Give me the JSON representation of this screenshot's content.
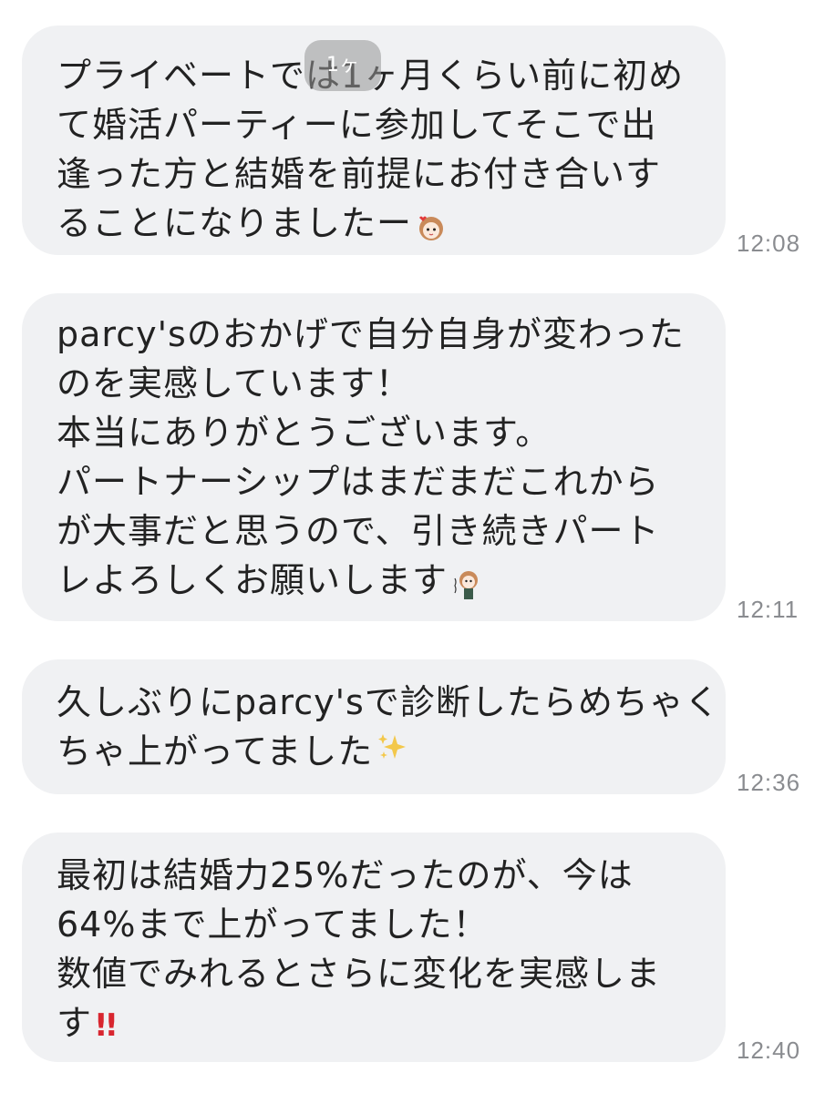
{
  "messages": [
    {
      "lines": [
        "プライベートでは1ヶ月くらい前に初め",
        "て婚活パーティーに参加してそこで出",
        "逢った方と結婚を前提にお付き合いす",
        "ることになりましたー"
      ],
      "emoji": "avatar-sticker",
      "time": "12:08"
    },
    {
      "lines": [
        "parcy'sのおかげで自分自身が変わった",
        "のを実感しています！",
        "本当にありがとうございます。",
        "パートナーシップはまだまだこれから",
        "が大事だと思うので、引き続きパート",
        "レよろしくお願いします"
      ],
      "emoji": "avatar-sticker",
      "time": "12:11"
    },
    {
      "lines": [
        "久しぶりにparcy'sで診断したらめちゃく",
        "ちゃ上がってました"
      ],
      "emoji": "sparkles",
      "time": "12:36"
    },
    {
      "lines": [
        "最初は結婚力25%だったのが、今は",
        "64%まで上がってました！",
        "数値でみれるとさらに変化を実感しま",
        "す"
      ],
      "emoji": "double-exclamation",
      "time": "12:40"
    }
  ],
  "overlay": {
    "badge_text": "1ヶ"
  },
  "colors": {
    "bubble": "#f0f1f3",
    "text": "#222222",
    "time": "#8a8c90",
    "accent_red": "#d8262f",
    "sparkle": "#f3c84b"
  }
}
